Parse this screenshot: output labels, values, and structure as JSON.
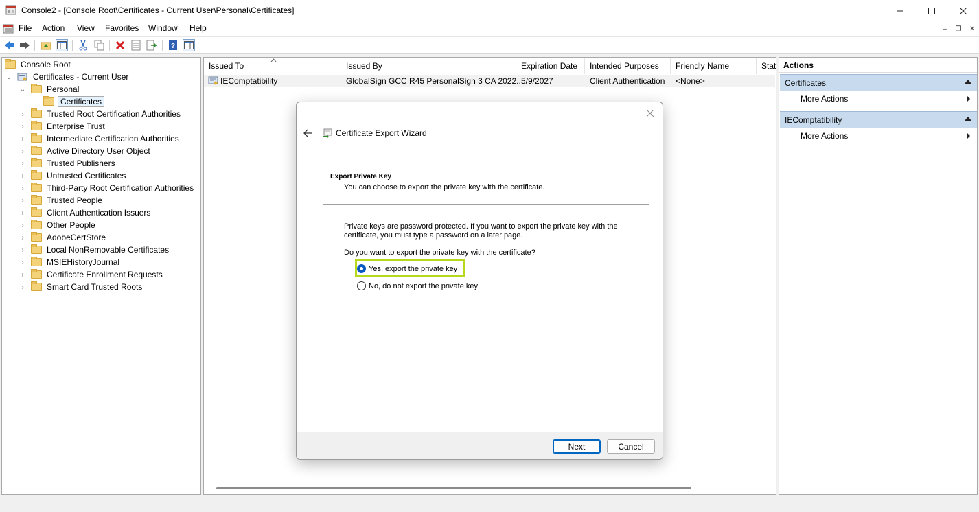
{
  "window": {
    "title": "Console2 - [Console Root\\Certificates - Current User\\Personal\\Certificates]"
  },
  "menu": [
    "File",
    "Action",
    "View",
    "Favorites",
    "Window",
    "Help"
  ],
  "tree": {
    "root": "Console Root",
    "store": "Certificates - Current User",
    "personal": "Personal",
    "selected": "Certificates",
    "folders": [
      "Trusted Root Certification Authorities",
      "Enterprise Trust",
      "Intermediate Certification Authorities",
      "Active Directory User Object",
      "Trusted Publishers",
      "Untrusted Certificates",
      "Third-Party Root Certification Authorities",
      "Trusted People",
      "Client Authentication Issuers",
      "Other People",
      "AdobeCertStore",
      "Local NonRemovable Certificates",
      "MSIEHistoryJournal",
      "Certificate Enrollment Requests",
      "Smart Card Trusted Roots"
    ]
  },
  "list": {
    "columns": [
      "Issued To",
      "Issued By",
      "Expiration Date",
      "Intended Purposes",
      "Friendly Name",
      "Stat"
    ],
    "rows": [
      {
        "issued_to": "IEComptatibility",
        "issued_by": "GlobalSign GCC R45 PersonalSign 3 CA 2022...",
        "expiration": "5/9/2027",
        "purposes": "Client Authentication",
        "friendly": "<None>"
      }
    ]
  },
  "actions": {
    "header": "Actions",
    "sections": [
      {
        "title": "Certificates",
        "item": "More Actions"
      },
      {
        "title": "IEComptatibility",
        "item": "More Actions"
      }
    ]
  },
  "dialog": {
    "title": "Certificate Export Wizard",
    "heading": "Export Private Key",
    "subheading": "You can choose to export the private key with the certificate.",
    "description": "Private keys are password protected. If you want to export the private key with the certificate, you must type a password on a later page.",
    "question": "Do you want to export the private key with the certificate?",
    "options": [
      {
        "label": "Yes, export the private key",
        "selected": true
      },
      {
        "label": "No, do not export the private key",
        "selected": false
      }
    ],
    "next_label": "Next",
    "cancel_label": "Cancel"
  },
  "colors": {
    "highlight": "#b7d91c",
    "accent": "#0067c0",
    "action_section": "#c8dbee"
  }
}
